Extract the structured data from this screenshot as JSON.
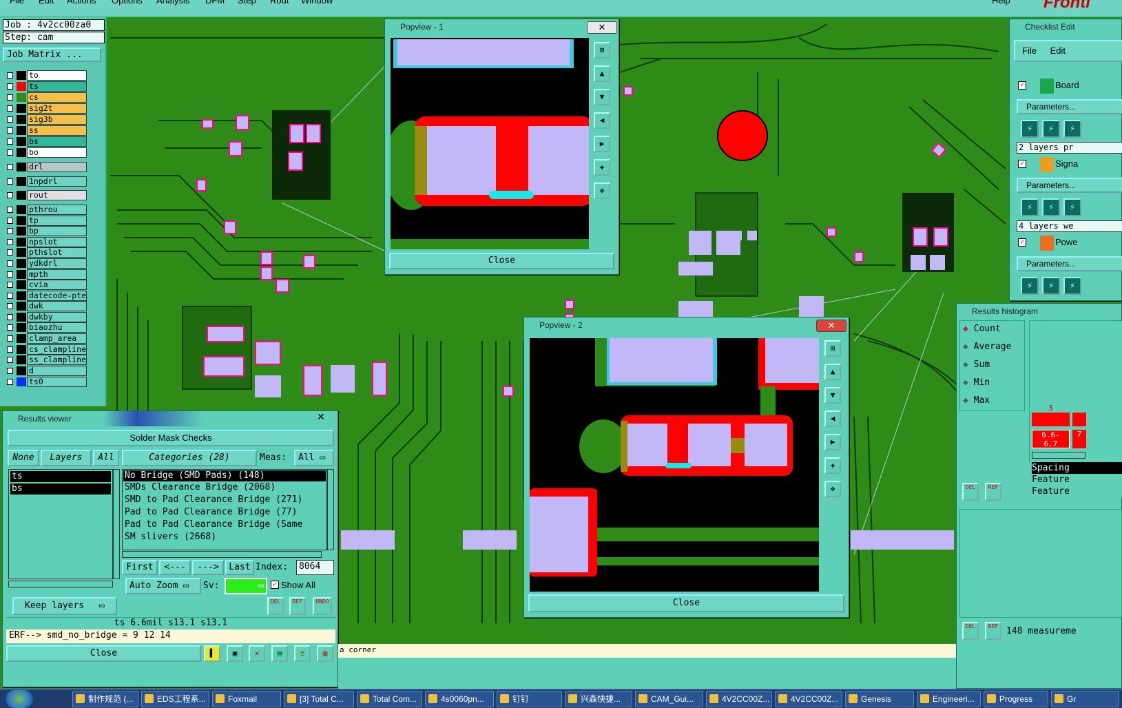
{
  "menubar": {
    "items": [
      "File",
      "Edit",
      "Actions",
      "Options",
      "Analysis",
      "DFM",
      "Step",
      "Rout",
      "Window"
    ],
    "help": "Help",
    "brand": "Fronti"
  },
  "job": {
    "job_line": "Job : 4v2cc00za0",
    "step_line": "Step: cam",
    "matrix_button": "Job Matrix ..."
  },
  "layers": [
    {
      "name": "to",
      "color": "#ffffff",
      "swatch": "#000000"
    },
    {
      "name": "ts",
      "color": "#2fb89a",
      "swatch": "#ff0000"
    },
    {
      "name": "cs",
      "color": "#f5c04a",
      "swatch": "#2f8b18"
    },
    {
      "name": "sig2t",
      "color": "#f5c04a",
      "swatch": "#000000"
    },
    {
      "name": "sig3b",
      "color": "#f5c04a",
      "swatch": "#000000"
    },
    {
      "name": "ss",
      "color": "#f5c04a",
      "swatch": "#000000"
    },
    {
      "name": "bs",
      "color": "#2fb89a",
      "swatch": "#000000"
    },
    {
      "name": "bo",
      "color": "#ffffff",
      "swatch": "#000000"
    },
    {
      "name": "drl",
      "color": "#b8c8c8",
      "swatch": "#000000"
    },
    {
      "name": "1npdrl",
      "color": "#6fd4c4",
      "swatch": "#000000"
    },
    {
      "name": "rout",
      "color": "#e0e0e0",
      "swatch": "#000000"
    },
    {
      "name": "pthrou",
      "color": "#6fd4c4",
      "swatch": "#000000"
    },
    {
      "name": "tp",
      "color": "#6fd4c4",
      "swatch": "#000000"
    },
    {
      "name": "bp",
      "color": "#6fd4c4",
      "swatch": "#000000"
    },
    {
      "name": "npslot",
      "color": "#6fd4c4",
      "swatch": "#000000"
    },
    {
      "name": "pthslot",
      "color": "#6fd4c4",
      "swatch": "#000000"
    },
    {
      "name": "ydkdrl",
      "color": "#6fd4c4",
      "swatch": "#000000"
    },
    {
      "name": "mpth",
      "color": "#6fd4c4",
      "swatch": "#000000"
    },
    {
      "name": "cvia",
      "color": "#6fd4c4",
      "swatch": "#000000"
    },
    {
      "name": "datecode-pte",
      "color": "#6fd4c4",
      "swatch": "#000000"
    },
    {
      "name": "dwk",
      "color": "#6fd4c4",
      "swatch": "#000000"
    },
    {
      "name": "dwkby",
      "color": "#6fd4c4",
      "swatch": "#000000"
    },
    {
      "name": "biaozhu",
      "color": "#6fd4c4",
      "swatch": "#000000"
    },
    {
      "name": "clamp_area",
      "color": "#6fd4c4",
      "swatch": "#000000"
    },
    {
      "name": "cs_clampline",
      "color": "#6fd4c4",
      "swatch": "#000000"
    },
    {
      "name": "ss_clampline",
      "color": "#6fd4c4",
      "swatch": "#000000"
    },
    {
      "name": "d",
      "color": "#6fd4c4",
      "swatch": "#000000"
    },
    {
      "name": "ts0",
      "color": "#6fd4c4",
      "swatch": "#0033ff"
    }
  ],
  "popview1": {
    "title": "Popview - 1",
    "close": "Close"
  },
  "popview2": {
    "title": "Popview - 2",
    "close": "Close"
  },
  "results": {
    "title": "Results viewer",
    "header": "Solder Mask Checks",
    "none": "None",
    "layers": "Layers",
    "all": "All",
    "categories": "Categories (28)",
    "meas": "Meas:",
    "meas_value": "All",
    "layer_list": [
      "ts",
      "bs"
    ],
    "category_list": [
      "No Bridge (SMD Pads) (148)",
      "SMDs Clearance Bridge (2068)",
      "SMD to Pad Clearance Bridge (271)",
      "Pad to Pad Clearance Bridge (77)",
      "Pad to Pad Clearance Bridge (Same",
      "SM slivers (2668)"
    ],
    "first": "First",
    "prev": "<---",
    "next": "--->",
    "last": "Last",
    "index_label": "Index:",
    "index_value": "8064",
    "auto_zoom": "Auto Zoom",
    "sv": "Sv:",
    "show_all": "Show All",
    "keep_layers": "Keep layers",
    "del": "DEL",
    "ref": "REF",
    "undo": "UNDO",
    "status": "ts 6.6mil  s13.1  s13.1",
    "erf": "ERF--> smd_no_bridge = 9 12 14",
    "close": "Close"
  },
  "status_strip": "a corner",
  "checklist": {
    "title": "Checklist Edit",
    "file": "File",
    "edit": "Edit",
    "items": [
      {
        "name": "Board",
        "params": "Parameters...",
        "summary": "2 layers pr"
      },
      {
        "name": "Signa",
        "params": "Parameters...",
        "summary": "4 layers we"
      },
      {
        "name": "Powe",
        "params": "Parameters...",
        "summary": ""
      }
    ]
  },
  "histogram": {
    "title": "Results histogram",
    "options": [
      "Count",
      "Average",
      "Sum",
      "Min",
      "Max"
    ],
    "bar_count": "3",
    "range_a": "6.6-",
    "range_a2": "6.7",
    "range_b": "7",
    "labels": [
      "Spacing",
      "Feature",
      "Feature"
    ],
    "del": "DEL",
    "ref": "REF",
    "measure": "148 measureme"
  },
  "taskbar": [
    "制作规范 (...",
    "EDS工程系...",
    "Foxmail",
    "[3] Total C...",
    "Total Com...",
    "4s0060pn...",
    "钉钉",
    "兴森快捷...",
    "CAM_Gui...",
    "4V2CC00Z...",
    "4V2CC00Z...",
    "Genesis",
    "Engineeri...",
    "Progress",
    "Gr"
  ]
}
